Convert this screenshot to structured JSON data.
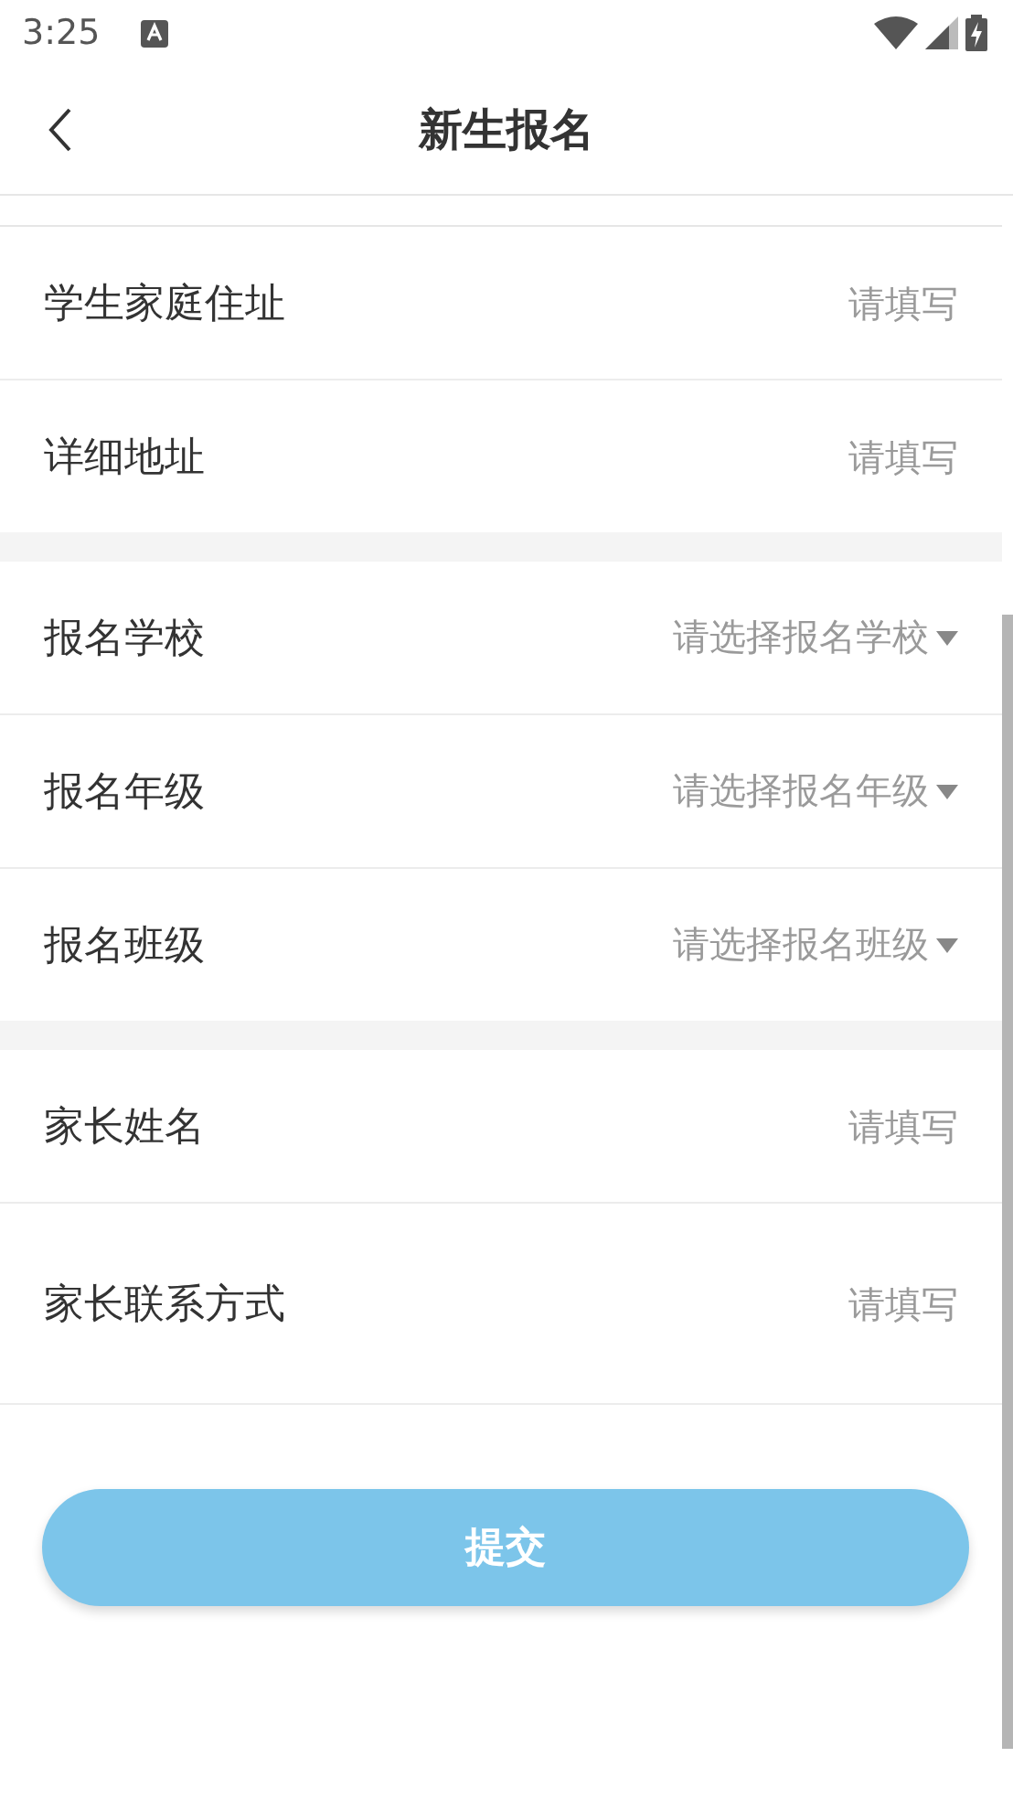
{
  "status_bar": {
    "time": "3:25"
  },
  "header": {
    "title": "新生报名"
  },
  "sections": [
    {
      "rows": [
        {
          "label": "学生家庭住址",
          "placeholder": "请填写",
          "kind": "text"
        },
        {
          "label": "详细地址",
          "placeholder": "请填写",
          "kind": "text"
        }
      ]
    },
    {
      "rows": [
        {
          "label": "报名学校",
          "placeholder": "请选择报名学校",
          "kind": "select"
        },
        {
          "label": "报名年级",
          "placeholder": "请选择报名年级",
          "kind": "select"
        },
        {
          "label": "报名班级",
          "placeholder": "请选择报名班级",
          "kind": "select"
        }
      ]
    },
    {
      "rows": [
        {
          "label": "家长姓名",
          "placeholder": "请填写",
          "kind": "text"
        },
        {
          "label": "家长联系方式",
          "placeholder": "请填写",
          "kind": "text"
        }
      ]
    }
  ],
  "submit": {
    "label": "提交"
  }
}
